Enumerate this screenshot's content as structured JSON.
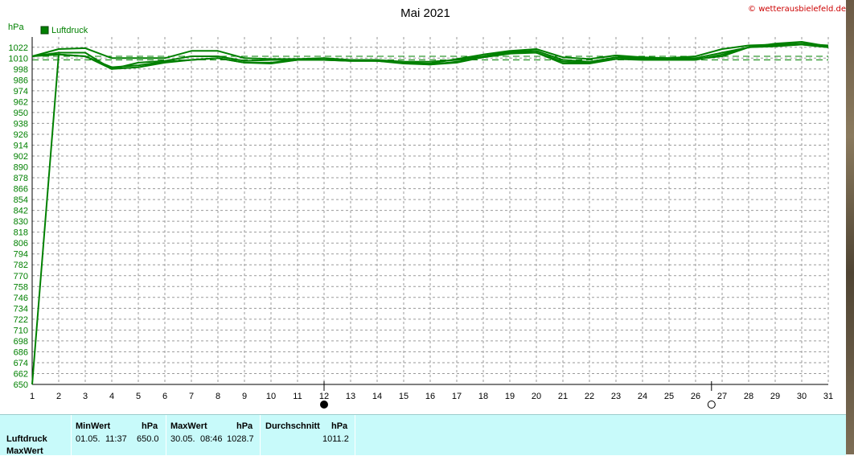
{
  "title": "Mai 2021",
  "copyright": "© wetterausbielefeld.de",
  "unit": "hPa",
  "legend": {
    "label": "Luftdruck",
    "color": "#008000"
  },
  "chart_data": {
    "type": "line",
    "title": "Mai 2021",
    "ylabel": "hPa",
    "xlabel": "",
    "ylim": [
      650,
      1028
    ],
    "xlim": [
      1,
      31
    ],
    "x_ticks": [
      1,
      2,
      3,
      4,
      5,
      6,
      7,
      8,
      9,
      10,
      11,
      12,
      13,
      14,
      15,
      16,
      17,
      18,
      19,
      20,
      21,
      22,
      23,
      24,
      25,
      26,
      27,
      28,
      29,
      30,
      31
    ],
    "y_ticks": [
      650,
      662,
      674,
      686,
      698,
      710,
      722,
      734,
      746,
      758,
      770,
      782,
      794,
      806,
      818,
      830,
      842,
      854,
      866,
      878,
      890,
      902,
      914,
      926,
      938,
      950,
      962,
      974,
      986,
      998,
      1010,
      1022
    ],
    "grid": true,
    "legend_position": "top-left",
    "reference_lines": [
      1008,
      1012
    ],
    "moon_phases": [
      {
        "day": 12,
        "phase": "new"
      },
      {
        "day": 27,
        "phase": "full"
      }
    ],
    "series": [
      {
        "name": "Luftdruck",
        "color": "#008000",
        "x": [
          1,
          2,
          3,
          4,
          5,
          6,
          7,
          8,
          9,
          10,
          11,
          12,
          13,
          14,
          15,
          16,
          17,
          18,
          19,
          20,
          21,
          22,
          23,
          24,
          25,
          26,
          27,
          28,
          29,
          30,
          31
        ],
        "values": [
          650,
          1014,
          1012,
          1000,
          1002,
          1006,
          1008,
          1010,
          1005,
          1005,
          1008,
          1008,
          1007,
          1007,
          1004,
          1003,
          1006,
          1011,
          1016,
          1016,
          1006,
          1005,
          1009,
          1009,
          1009,
          1009,
          1012,
          1022,
          1024,
          1025,
          1022
        ]
      },
      {
        "name": "",
        "x": [
          1,
          2,
          3,
          4,
          5,
          6,
          7,
          8,
          9,
          10,
          11,
          12,
          13,
          14,
          15,
          16,
          17,
          18,
          19,
          20,
          21,
          22,
          23,
          24,
          25,
          26,
          27,
          28,
          29,
          30,
          31
        ],
        "values": [
          1012,
          1020,
          1021,
          1010,
          1010,
          1010,
          1018,
          1018,
          1010,
          1009,
          1009,
          1010,
          1008,
          1007,
          1005,
          1004,
          1009,
          1014,
          1018,
          1020,
          1011,
          1009,
          1013,
          1011,
          1010,
          1010,
          1016,
          1022,
          1026,
          1028,
          1023
        ]
      },
      {
        "name": "",
        "x": [
          1,
          2,
          3,
          4,
          5,
          6,
          7,
          8,
          9,
          10,
          11,
          12,
          13,
          14,
          15,
          16,
          17,
          18,
          19,
          20,
          21,
          22,
          23,
          24,
          25,
          26,
          27,
          28,
          29,
          30,
          31
        ],
        "values": [
          1012,
          1016,
          1016,
          998,
          1005,
          1007,
          1012,
          1012,
          1007,
          1008,
          1008,
          1008,
          1008,
          1008,
          1006,
          1006,
          1008,
          1012,
          1017,
          1018,
          1008,
          1006,
          1011,
          1010,
          1010,
          1012,
          1020,
          1024,
          1025,
          1026,
          1024
        ]
      },
      {
        "name": "",
        "x": [
          1,
          2,
          3,
          4,
          5,
          6,
          7,
          8,
          9,
          10,
          11,
          12,
          13,
          14,
          15,
          16,
          17,
          18,
          19,
          20,
          21,
          22,
          23,
          24,
          25,
          26,
          27,
          28,
          29,
          30,
          31
        ],
        "values": [
          1012,
          1014,
          1012,
          998,
          1000,
          1005,
          1008,
          1010,
          1005,
          1004,
          1008,
          1008,
          1007,
          1007,
          1005,
          1003,
          1005,
          1011,
          1015,
          1016,
          1004,
          1004,
          1009,
          1008,
          1008,
          1008,
          1014,
          1022,
          1023,
          1025,
          1022
        ]
      }
    ]
  },
  "stats": {
    "row_label": "Luftdruck",
    "row_label2": "MaxWert",
    "min": {
      "header": "MinWert",
      "unit": "hPa",
      "date": "01.05.",
      "time": "11:37",
      "value": "650.0"
    },
    "max": {
      "header": "MaxWert",
      "unit": "hPa",
      "date": "30.05.",
      "time": "08:46",
      "value": "1028.7"
    },
    "avg": {
      "header": "Durchschnitt",
      "unit": "hPa",
      "value": "1011.2"
    }
  }
}
